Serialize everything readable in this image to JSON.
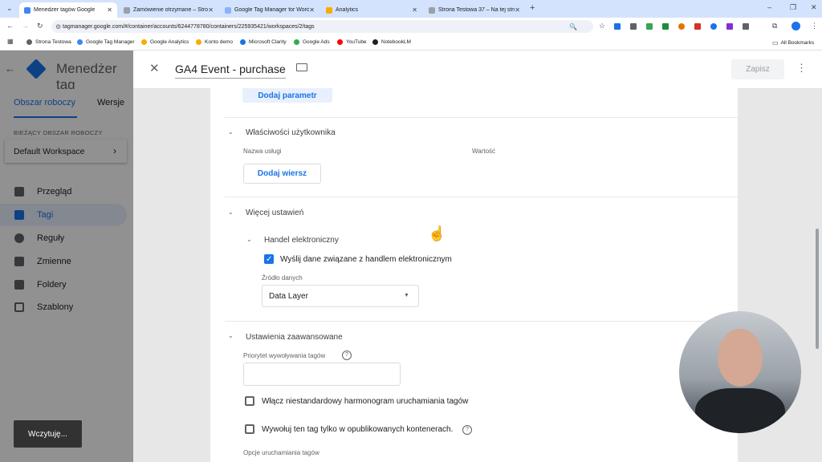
{
  "browser": {
    "tabs": [
      {
        "title": "Menedżer tagów Google",
        "active": true
      },
      {
        "title": "Zamówienie otrzymane – Stron"
      },
      {
        "title": "Google Tag Manager for Word"
      },
      {
        "title": "Analytics"
      },
      {
        "title": "Strona Testowa 37 – Na tej stro"
      }
    ],
    "new_tab": "+",
    "url": "tagmanager.google.com/#/container/accounts/6244778780/containers/225935421/workspaces/2/tags",
    "bookmarks": [
      "Strona Testowa",
      "Google Tag Manager",
      "Google Analytics",
      "Konto demo",
      "Microsoft Clarity",
      "Google Ads",
      "YouTube",
      "NotebookLM"
    ],
    "all_bookmarks": "All Bookmarks",
    "window_controls": {
      "minimize": "–",
      "maximize": "❐",
      "close": "✕"
    }
  },
  "gtm": {
    "app_title": "Menedżer tag",
    "tabs": [
      "Obszar roboczy",
      "Wersje"
    ],
    "workspace_label": "BIEŻĄCY OBSZAR ROBOCZY",
    "workspace_name": "Default Workspace",
    "nav": [
      "Przegląd",
      "Tagi",
      "Reguły",
      "Zmienne",
      "Foldery",
      "Szablony"
    ],
    "loading": "Wczytuję..."
  },
  "tag": {
    "title": "GA4 Event - purchase",
    "save": "Zapisz",
    "add_param": "Dodaj parametr",
    "user_props": {
      "title": "Właściwości użytkownika",
      "col_name": "Nazwa usługi",
      "col_value": "Wartość",
      "add_row": "Dodaj wiersz"
    },
    "more_settings": {
      "title": "Więcej ustawień",
      "ecommerce": "Handel elektroniczny",
      "send_ecom": "Wyślij dane związane z handlem elektronicznym",
      "send_ecom_checked": true,
      "source_label": "Źródło danych",
      "source_value": "Data Layer"
    },
    "advanced": {
      "title": "Ustawienia zaawansowane",
      "priority_label": "Priorytet wywoływania tagów",
      "priority_value": "",
      "custom_schedule": "Włącz niestandardowy harmonogram uruchamiania tagów",
      "only_published": "Wywołuj ten tag tylko w opublikowanych kontenerach.",
      "firing_options": "Opcje uruchamiania tagów"
    }
  },
  "colors": {
    "accent": "#1a73e8",
    "tab_strip": "#d3e3fd"
  }
}
